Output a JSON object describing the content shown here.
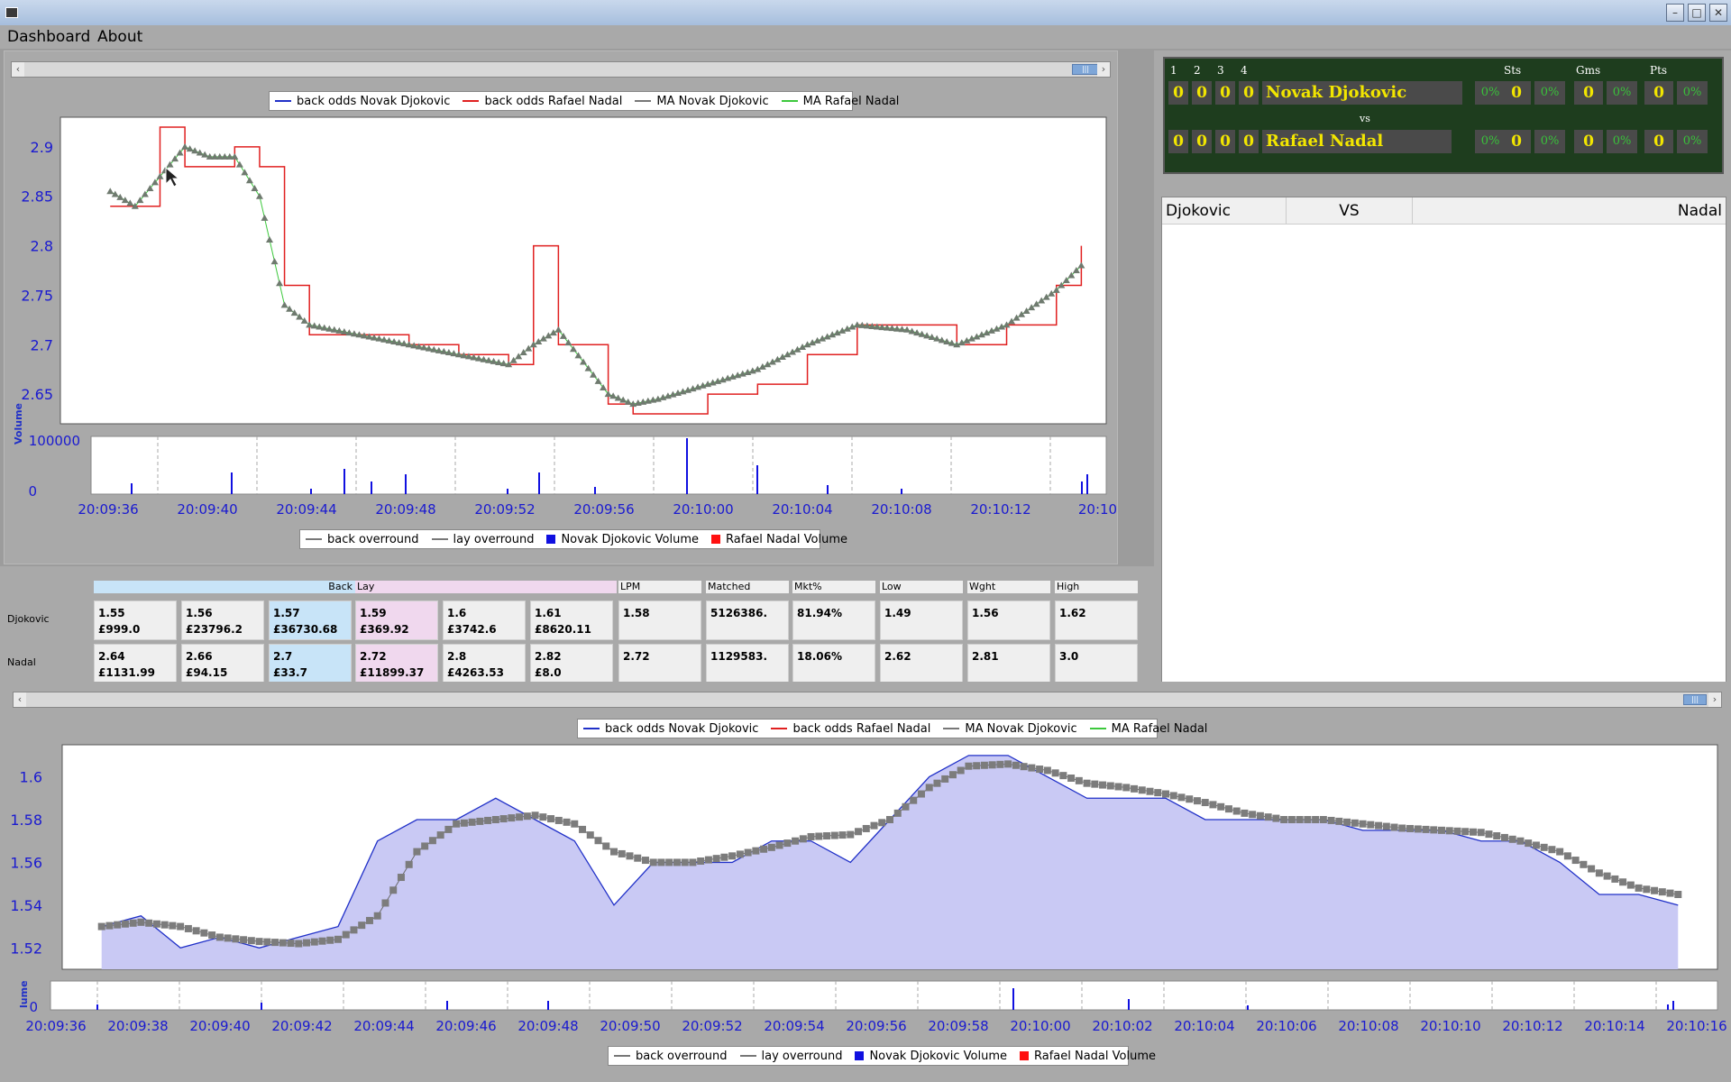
{
  "app": {
    "menu": [
      "Dashboard",
      "About"
    ]
  },
  "top_chart": {
    "legend": [
      {
        "label": "back odds Novak Djokovic",
        "color": "#2030c8",
        "kind": "line"
      },
      {
        "label": "back odds Rafael Nadal",
        "color": "#e02020",
        "kind": "line"
      },
      {
        "label": "MA Novak Djokovic",
        "color": "#777777",
        "kind": "square"
      },
      {
        "label": "MA Rafael Nadal",
        "color": "#3cc83c",
        "kind": "triangle"
      }
    ],
    "volume_legend": [
      {
        "label": "back overround",
        "color": "#777777",
        "kind": "circle"
      },
      {
        "label": "lay overround",
        "color": "#777777",
        "kind": "circle"
      },
      {
        "label": "Novak Djokovic Volume",
        "color": "#1010e0",
        "kind": "box"
      },
      {
        "label": "Rafael Nadal Volume",
        "color": "#ff1010",
        "kind": "box"
      }
    ],
    "y_ticks": [
      "2.9",
      "2.85",
      "2.8",
      "2.75",
      "2.7",
      "2.65"
    ],
    "volume_label": "Volume",
    "volume_ticks": [
      "100000",
      "0"
    ],
    "x_ticks": [
      "20:09:36",
      "20:09:40",
      "20:09:44",
      "20:09:48",
      "20:09:52",
      "20:09:56",
      "20:10:00",
      "20:10:04",
      "20:10:08",
      "20:10:12",
      "20:10:"
    ]
  },
  "bottom_chart": {
    "legend": [
      {
        "label": "back odds Novak Djokovic",
        "color": "#2030c8",
        "kind": "line"
      },
      {
        "label": "back odds Rafael Nadal",
        "color": "#e02020",
        "kind": "line"
      },
      {
        "label": "MA Novak Djokovic",
        "color": "#777777",
        "kind": "square"
      },
      {
        "label": "MA Rafael Nadal",
        "color": "#3cc83c",
        "kind": "triangle"
      }
    ],
    "volume_legend": [
      {
        "label": "back overround",
        "color": "#777777",
        "kind": "circle"
      },
      {
        "label": "lay overround",
        "color": "#777777",
        "kind": "circle"
      },
      {
        "label": "Novak Djokovic Volume",
        "color": "#1010e0",
        "kind": "box"
      },
      {
        "label": "Rafael Nadal Volume",
        "color": "#ff1010",
        "kind": "box"
      }
    ],
    "y_ticks": [
      "1.6",
      "1.58",
      "1.56",
      "1.54",
      "1.52"
    ],
    "volume_label": "lume",
    "volume_ticks": [
      "0"
    ],
    "x_ticks": [
      "20:09:36",
      "20:09:38",
      "20:09:40",
      "20:09:42",
      "20:09:44",
      "20:09:46",
      "20:09:48",
      "20:09:50",
      "20:09:52",
      "20:09:54",
      "20:09:56",
      "20:09:58",
      "20:10:00",
      "20:10:02",
      "20:10:04",
      "20:10:06",
      "20:10:08",
      "20:10:10",
      "20:10:12",
      "20:10:14",
      "20:10:16"
    ]
  },
  "market": {
    "headers": {
      "back": "Back",
      "lay": "Lay",
      "lpm": "LPM",
      "matched": "Matched",
      "mkt": "Mkt%",
      "low": "Low",
      "wght": "Wght",
      "high": "High"
    },
    "rows": [
      {
        "name": "Djokovic",
        "back": [
          {
            "odds": "1.55",
            "amount": "£999.0"
          },
          {
            "odds": "1.56",
            "amount": "£23796.2"
          },
          {
            "odds": "1.57",
            "amount": "£36730.68"
          }
        ],
        "lay": [
          {
            "odds": "1.59",
            "amount": "£369.92"
          },
          {
            "odds": "1.6",
            "amount": "£3742.6"
          },
          {
            "odds": "1.61",
            "amount": "£8620.11"
          }
        ],
        "lpm": "1.58",
        "matched": "5126386.",
        "mkt": "81.94%",
        "low": "1.49",
        "wght": "1.56",
        "high": "1.62"
      },
      {
        "name": "Nadal",
        "back": [
          {
            "odds": "2.64",
            "amount": "£1131.99"
          },
          {
            "odds": "2.66",
            "amount": "£94.15"
          },
          {
            "odds": "2.7",
            "amount": "£33.7"
          }
        ],
        "lay": [
          {
            "odds": "2.72",
            "amount": "£11899.37"
          },
          {
            "odds": "2.8",
            "amount": "£4263.53"
          },
          {
            "odds": "2.82",
            "amount": "£8.0"
          }
        ],
        "lpm": "2.72",
        "matched": "1129583.",
        "mkt": "18.06%",
        "low": "2.62",
        "wght": "2.81",
        "high": "3.0"
      }
    ]
  },
  "scoreboard": {
    "set_headers": [
      "1",
      "2",
      "3",
      "4"
    ],
    "col_headers": [
      "Sts",
      "Gms",
      "Pts"
    ],
    "vs": "vs",
    "players": [
      {
        "name": "Novak Djokovic",
        "sets": [
          "0",
          "0",
          "0",
          "0"
        ],
        "pct1": "0%",
        "sts": "0",
        "pct2": "0%",
        "gms": "0",
        "pct3": "0%",
        "pts": "0",
        "pct4": "0%"
      },
      {
        "name": "Rafael Nadal",
        "sets": [
          "0",
          "0",
          "0",
          "0"
        ],
        "pct1": "0%",
        "sts": "0",
        "pct2": "0%",
        "gms": "0",
        "pct3": "0%",
        "pts": "0",
        "pct4": "0%"
      }
    ]
  },
  "versus": {
    "left": "Djokovic",
    "center": "VS",
    "right": "Nadal"
  },
  "chart_data": [
    {
      "type": "line",
      "title": "",
      "series": [
        {
          "name": "back odds Rafael Nadal",
          "color": "#e02020",
          "x": [
            "20:09:36",
            "20:09:37",
            "20:09:38",
            "20:09:39",
            "20:09:40",
            "20:09:41",
            "20:09:42",
            "20:09:43",
            "20:09:44",
            "20:09:46",
            "20:09:48",
            "20:09:50",
            "20:09:52",
            "20:09:53",
            "20:09:54",
            "20:09:56",
            "20:09:57",
            "20:09:58",
            "20:10:00",
            "20:10:02",
            "20:10:04",
            "20:10:06",
            "20:10:08",
            "20:10:10",
            "20:10:12",
            "20:10:14",
            "20:10:15"
          ],
          "values": [
            2.84,
            2.84,
            2.92,
            2.88,
            2.88,
            2.9,
            2.88,
            2.76,
            2.71,
            2.71,
            2.7,
            2.69,
            2.68,
            2.8,
            2.7,
            2.64,
            2.63,
            2.63,
            2.65,
            2.66,
            2.69,
            2.72,
            2.72,
            2.7,
            2.72,
            2.76,
            2.8
          ]
        },
        {
          "name": "MA Rafael Nadal",
          "color": "#777777",
          "x": [
            "20:09:36",
            "20:09:37",
            "20:09:38",
            "20:09:39",
            "20:09:40",
            "20:09:41",
            "20:09:42",
            "20:09:43",
            "20:09:44",
            "20:09:46",
            "20:09:48",
            "20:09:50",
            "20:09:52",
            "20:09:53",
            "20:09:54",
            "20:09:56",
            "20:09:57",
            "20:09:58",
            "20:10:00",
            "20:10:02",
            "20:10:04",
            "20:10:06",
            "20:10:08",
            "20:10:10",
            "20:10:12",
            "20:10:14",
            "20:10:15"
          ],
          "values": [
            2.855,
            2.84,
            2.87,
            2.9,
            2.89,
            2.89,
            2.85,
            2.74,
            2.72,
            2.71,
            2.7,
            2.69,
            2.68,
            2.7,
            2.715,
            2.65,
            2.64,
            2.645,
            2.66,
            2.675,
            2.7,
            2.72,
            2.715,
            2.7,
            2.72,
            2.755,
            2.78
          ]
        }
      ],
      "ylim": [
        2.62,
        2.93
      ]
    },
    {
      "type": "area",
      "title": "",
      "series": [
        {
          "name": "back odds Novak Djokovic",
          "color": "#2030c8",
          "x": [
            "20:09:36",
            "20:09:37",
            "20:09:38",
            "20:09:39",
            "20:09:40",
            "20:09:41",
            "20:09:42",
            "20:09:43",
            "20:09:44",
            "20:09:45",
            "20:09:46",
            "20:09:47",
            "20:09:48",
            "20:09:49",
            "20:09:50",
            "20:09:51",
            "20:09:52",
            "20:09:53",
            "20:09:54",
            "20:09:55",
            "20:09:56",
            "20:09:57",
            "20:09:58",
            "20:09:59",
            "20:10:00",
            "20:10:01",
            "20:10:02",
            "20:10:03",
            "20:10:04",
            "20:10:05",
            "20:10:06",
            "20:10:07",
            "20:10:08",
            "20:10:09",
            "20:10:10",
            "20:10:11",
            "20:10:12",
            "20:10:13",
            "20:10:14",
            "20:10:15",
            "20:10:16"
          ],
          "values": [
            1.53,
            1.535,
            1.52,
            1.525,
            1.52,
            1.525,
            1.53,
            1.57,
            1.58,
            1.58,
            1.59,
            1.58,
            1.57,
            1.54,
            1.56,
            1.56,
            1.56,
            1.57,
            1.57,
            1.56,
            1.58,
            1.6,
            1.61,
            1.61,
            1.6,
            1.59,
            1.59,
            1.59,
            1.58,
            1.58,
            1.58,
            1.58,
            1.575,
            1.575,
            1.575,
            1.57,
            1.57,
            1.56,
            1.545,
            1.545,
            1.54
          ]
        },
        {
          "name": "MA Novak Djokovic",
          "color": "#777777",
          "x": [
            "20:09:36",
            "20:09:37",
            "20:09:38",
            "20:09:39",
            "20:09:40",
            "20:09:41",
            "20:09:42",
            "20:09:43",
            "20:09:44",
            "20:09:45",
            "20:09:46",
            "20:09:47",
            "20:09:48",
            "20:09:49",
            "20:09:50",
            "20:09:51",
            "20:09:52",
            "20:09:53",
            "20:09:54",
            "20:09:55",
            "20:09:56",
            "20:09:57",
            "20:09:58",
            "20:09:59",
            "20:10:00",
            "20:10:01",
            "20:10:02",
            "20:10:03",
            "20:10:04",
            "20:10:05",
            "20:10:06",
            "20:10:07",
            "20:10:08",
            "20:10:09",
            "20:10:10",
            "20:10:11",
            "20:10:12",
            "20:10:13",
            "20:10:14",
            "20:10:15",
            "20:10:16"
          ],
          "values": [
            1.53,
            1.532,
            1.53,
            1.525,
            1.523,
            1.522,
            1.524,
            1.535,
            1.565,
            1.578,
            1.58,
            1.582,
            1.578,
            1.565,
            1.56,
            1.56,
            1.563,
            1.567,
            1.572,
            1.573,
            1.58,
            1.595,
            1.605,
            1.606,
            1.603,
            1.597,
            1.595,
            1.592,
            1.588,
            1.583,
            1.58,
            1.58,
            1.578,
            1.576,
            1.575,
            1.574,
            1.57,
            1.565,
            1.555,
            1.548,
            1.545
          ]
        }
      ],
      "ylim": [
        1.51,
        1.615
      ]
    }
  ]
}
